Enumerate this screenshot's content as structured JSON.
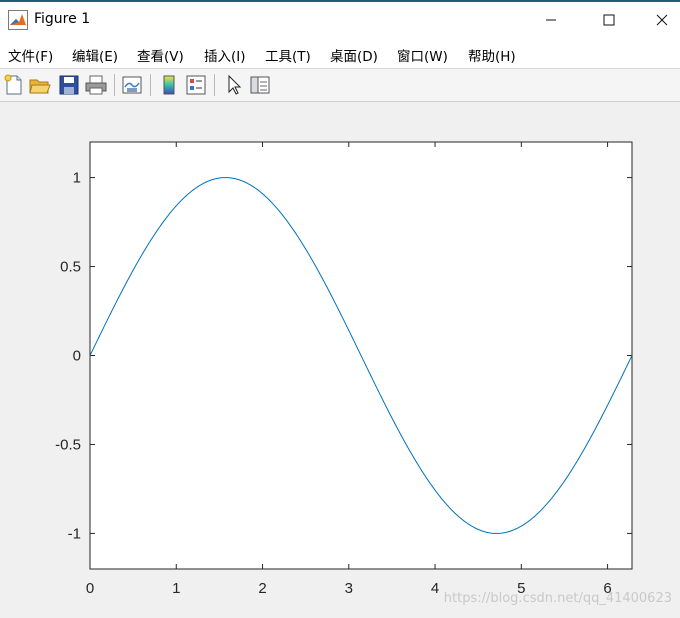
{
  "window": {
    "title": "Figure 1",
    "controls": {
      "minimize": "minimize",
      "maximize": "maximize",
      "close": "close"
    }
  },
  "menu": [
    {
      "label": "文件(F)"
    },
    {
      "label": "编辑(E)"
    },
    {
      "label": "查看(V)"
    },
    {
      "label": "插入(I)"
    },
    {
      "label": "工具(T)"
    },
    {
      "label": "桌面(D)"
    },
    {
      "label": "窗口(W)"
    },
    {
      "label": "帮助(H)"
    }
  ],
  "toolbar": [
    {
      "icon": "new-figure-icon"
    },
    {
      "icon": "open-folder-icon"
    },
    {
      "icon": "save-icon"
    },
    {
      "icon": "print-icon"
    },
    {
      "icon": "link-plot-icon"
    },
    {
      "icon": "insert-colorbar-icon"
    },
    {
      "icon": "insert-legend-icon"
    },
    {
      "icon": "edit-plot-arrow-icon"
    },
    {
      "icon": "plot-tools-icon"
    }
  ],
  "watermark": "https://blog.csdn.net/qq_41400623",
  "chart_data": {
    "type": "line",
    "function": "sin(x)",
    "x_range": [
      0,
      6.283185
    ],
    "xlim": [
      0,
      6.283185
    ],
    "ylim": [
      -1.2,
      1.2
    ],
    "xticks": [
      0,
      1,
      2,
      3,
      4,
      5,
      6
    ],
    "yticks": [
      -1,
      -0.5,
      0,
      0.5,
      1
    ],
    "ytick_labels": [
      "-1",
      "-0.5",
      "0",
      "0.5",
      "1"
    ],
    "xtick_labels": [
      "0",
      "1",
      "2",
      "3",
      "4",
      "5",
      "6"
    ],
    "grid": false,
    "series": [
      {
        "color": "#0072bd",
        "x": [
          0,
          0.3927,
          0.7854,
          1.1781,
          1.5708,
          1.9635,
          2.3562,
          2.7489,
          3.1416,
          3.5343,
          3.927,
          4.3197,
          4.7124,
          5.1051,
          5.4978,
          5.8905,
          6.2832
        ],
        "y": [
          0,
          0.3827,
          0.7071,
          0.9239,
          1,
          0.9239,
          0.7071,
          0.3827,
          0,
          -0.3827,
          -0.7071,
          -0.9239,
          -1,
          -0.9239,
          -0.7071,
          -0.3827,
          0
        ]
      }
    ]
  }
}
